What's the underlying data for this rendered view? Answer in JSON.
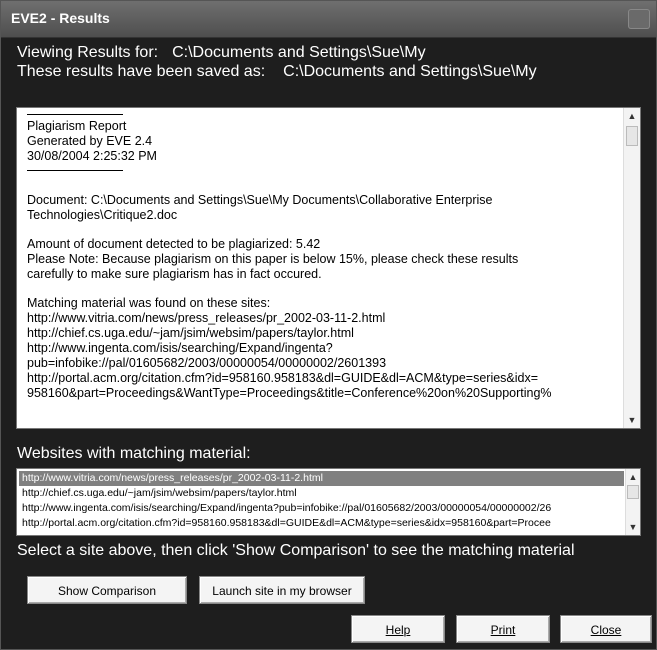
{
  "window": {
    "title": "EVE2 - Results"
  },
  "header": {
    "viewing_label": "Viewing Results for:",
    "viewing_value": "C:\\Documents and Settings\\Sue\\My",
    "saved_label": "These results have been saved as:",
    "saved_value": "C:\\Documents and Settings\\Sue\\My"
  },
  "report": {
    "title": "Plagiarism Report",
    "generated": "Generated by EVE 2.4",
    "datetime": "30/08/2004 2:25:32 PM",
    "document_line1": "Document: C:\\Documents and Settings\\Sue\\My Documents\\Collaborative Enterprise",
    "document_line2": "Technologies\\Critique2.doc",
    "amount": "Amount of document detected to be plagiarized: 5.42",
    "note_line1": "Please Note: Because plagiarism on this paper is below 15%, please check these results",
    "note_line2": "carefully to make sure plagiarism has in fact occured.",
    "matching_header": "Matching material was found on these sites:",
    "sites": [
      "http://www.vitria.com/news/press_releases/pr_2002-03-11-2.html",
      "http://chief.cs.uga.edu/~jam/jsim/websim/papers/taylor.html",
      "http://www.ingenta.com/isis/searching/Expand/ingenta?",
      "pub=infobike://pal/01605682/2003/00000054/00000002/2601393",
      "http://portal.acm.org/citation.cfm?id=958160.958183&dl=GUIDE&dl=ACM&type=series&idx=",
      "958160&part=Proceedings&WantType=Proceedings&title=Conference%20on%20Supporting%"
    ]
  },
  "websites_label": "Websites with matching material:",
  "websites_list": [
    "http://www.vitria.com/news/press_releases/pr_2002-03-11-2.html",
    "http://chief.cs.uga.edu/~jam/jsim/websim/papers/taylor.html",
    "http://www.ingenta.com/isis/searching/Expand/ingenta?pub=infobike://pal/01605682/2003/00000054/00000002/26",
    "http://portal.acm.org/citation.cfm?id=958160.958183&dl=GUIDE&dl=ACM&type=series&idx=958160&part=Procee"
  ],
  "hint": "Select a site above, then click 'Show Comparison' to see the matching material",
  "buttons": {
    "show_comparison": "Show Comparison",
    "launch_site": "Launch site in my browser",
    "help": "Help",
    "print": "Print",
    "close": "Close"
  },
  "icons": {
    "scroll_up": "scroll-up-icon",
    "scroll_down": "scroll-down-icon"
  }
}
